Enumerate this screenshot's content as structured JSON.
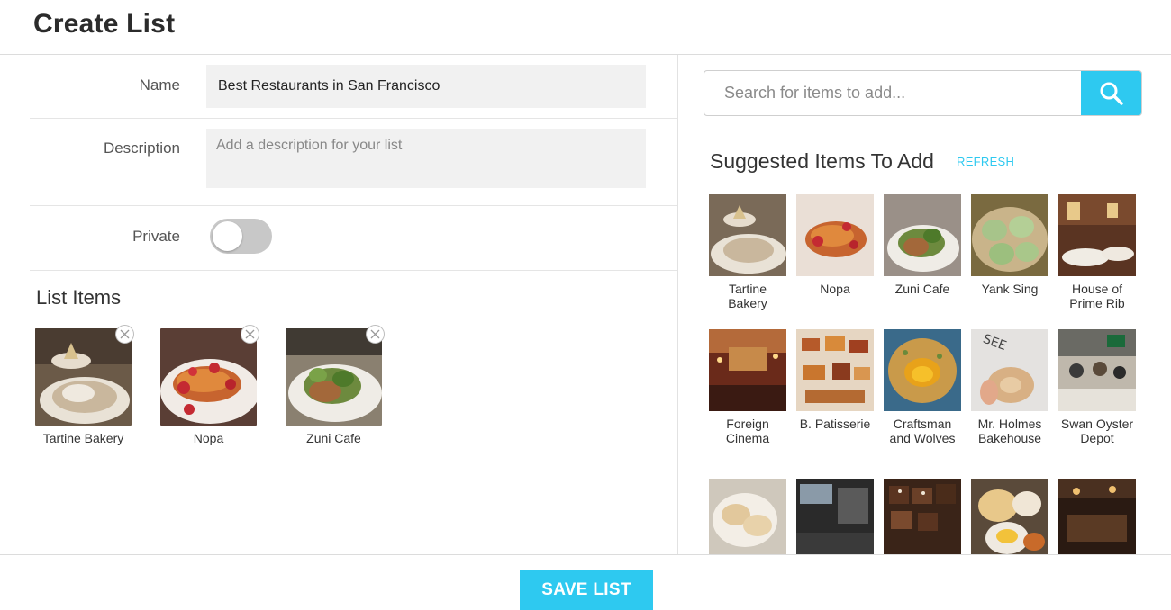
{
  "header": {
    "title": "Create List"
  },
  "form": {
    "name_label": "Name",
    "name_value": "Best Restaurants in San Francisco",
    "description_label": "Description",
    "description_placeholder": "Add a description for your list",
    "private_label": "Private",
    "private_on": false
  },
  "list_items": {
    "title": "List Items",
    "items": [
      {
        "label": "Tartine Bakery"
      },
      {
        "label": "Nopa"
      },
      {
        "label": "Zuni Cafe"
      }
    ]
  },
  "search": {
    "placeholder": "Search for items to add..."
  },
  "suggested": {
    "title": "Suggested Items To Add",
    "refresh_label": "REFRESH",
    "items": [
      {
        "label": "Tartine Bakery"
      },
      {
        "label": "Nopa"
      },
      {
        "label": "Zuni Cafe"
      },
      {
        "label": "Yank Sing"
      },
      {
        "label": "House of Prime Rib"
      },
      {
        "label": "Foreign Cinema"
      },
      {
        "label": "B. Patisserie"
      },
      {
        "label": "Craftsman and Wolves"
      },
      {
        "label": "Mr. Holmes Bakehouse"
      },
      {
        "label": "Swan Oyster Depot"
      },
      {
        "label": ""
      },
      {
        "label": ""
      },
      {
        "label": ""
      },
      {
        "label": ""
      },
      {
        "label": ""
      }
    ]
  },
  "footer": {
    "save_label": "SAVE LIST"
  },
  "colors": {
    "accent": "#2ec9f0",
    "input_bg": "#f1f1f1",
    "toggle_off": "#c8c8c8"
  },
  "icons": {
    "search": "search-icon",
    "remove": "close-circle-icon"
  }
}
